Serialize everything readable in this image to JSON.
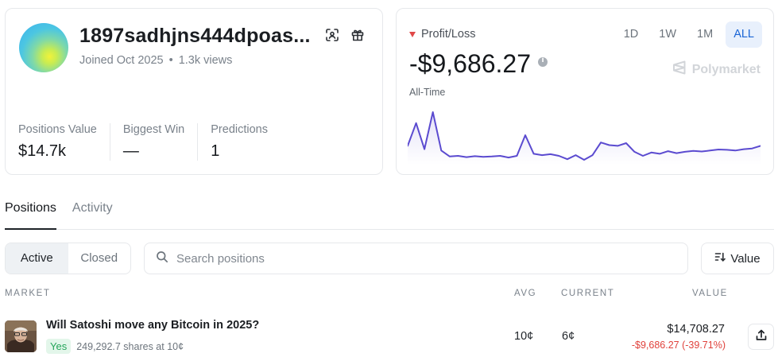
{
  "profile": {
    "username": "1897sadhjns444dpoas...",
    "joined": "Joined Oct 2025",
    "separator": "•",
    "views": "1.3k views",
    "stats": [
      {
        "label": "Positions Value",
        "value": "$14.7k"
      },
      {
        "label": "Biggest Win",
        "value": "—"
      },
      {
        "label": "Predictions",
        "value": "1"
      }
    ]
  },
  "pnl": {
    "label": "Profit/Loss",
    "value": "-$9,686.27",
    "period": "All-Time",
    "ranges": [
      "1D",
      "1W",
      "1M",
      "ALL"
    ],
    "active_range": "ALL",
    "brand": "Polymarket",
    "line_color": "#5b4bd0"
  },
  "chart_data": {
    "type": "area",
    "title": "",
    "xlabel": "",
    "ylabel": "",
    "series": [
      {
        "values": [
          -5200,
          -1800,
          -5700,
          -150,
          -5900,
          -6800,
          -6700,
          -6900,
          -6750,
          -6850,
          -6800,
          -6700,
          -6950,
          -6700,
          -3600,
          -6400,
          -6600,
          -6450,
          -6700,
          -7200,
          -6600,
          -7300,
          -6600,
          -4700,
          -5100,
          -5200,
          -4800,
          -6100,
          -6700,
          -6200,
          -6400,
          -6000,
          -6300,
          -6100,
          -5950,
          -6050,
          -5900,
          -5750,
          -5800,
          -5900,
          -5700,
          -5600,
          -5200
        ]
      }
    ]
  },
  "tabs": [
    "Positions",
    "Activity"
  ],
  "filters": {
    "segments": [
      "Active",
      "Closed"
    ],
    "search_placeholder": "Search positions",
    "sort_label": "Value"
  },
  "table": {
    "headers": {
      "market": "MARKET",
      "avg": "AVG",
      "current": "CURRENT",
      "value": "VALUE"
    },
    "rows": [
      {
        "title": "Will Satoshi move any Bitcoin in 2025?",
        "outcome": "Yes",
        "shares": "249,292.7 shares at 10¢",
        "avg": "10¢",
        "current": "6¢",
        "value": "$14,708.27",
        "pnl": "-$9,686.27 (-39.71%)"
      }
    ]
  },
  "colors": {
    "accent": "#1a65d6",
    "loss": "#e0413b",
    "yes": "#26a55a"
  }
}
